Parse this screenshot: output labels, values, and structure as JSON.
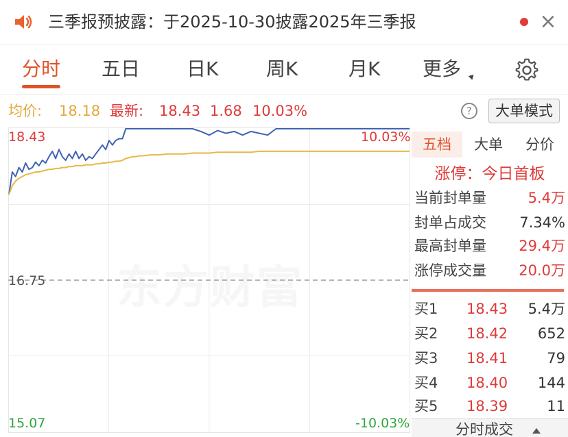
{
  "notice": {
    "text": "三季报预披露：于2025-10-30披露2025年三季报",
    "speaker_icon": "speaker-icon",
    "dot_color": "#e03a3a",
    "close_label": "×"
  },
  "tabs": [
    {
      "label": "分时",
      "active": true
    },
    {
      "label": "五日",
      "active": false
    },
    {
      "label": "日K",
      "active": false
    },
    {
      "label": "周K",
      "active": false
    },
    {
      "label": "月K",
      "active": false
    },
    {
      "label": "更多",
      "active": false
    }
  ],
  "info": {
    "avg_label": "均价:",
    "avg_value": "18.18",
    "latest_label": "最新:",
    "latest_price": "18.43",
    "change": "1.68",
    "change_pct": "10.03%",
    "help_label": "?",
    "mode_button": "大单模式"
  },
  "chart": {
    "y_top": "18.43",
    "y_mid": "16.75",
    "y_bottom": "15.07",
    "pct_top": "10.03%",
    "pct_bottom": "-10.03%",
    "watermark": "东方财富"
  },
  "chart_data": {
    "type": "line",
    "ylim": [
      15.07,
      18.43
    ],
    "prev_close": 16.75,
    "x": [
      0,
      2,
      4,
      6,
      8,
      10,
      12,
      14,
      16,
      18,
      20,
      22,
      24,
      26,
      28,
      30,
      32,
      34,
      36,
      38,
      40,
      42,
      44,
      46,
      48,
      50,
      52,
      54,
      56,
      58,
      60,
      62,
      64,
      66,
      68,
      70,
      72,
      74,
      76,
      78,
      80,
      85,
      90,
      95,
      100,
      105,
      110,
      115,
      120,
      125,
      130,
      135,
      140,
      145,
      150,
      155,
      160,
      165,
      170,
      175,
      180,
      185,
      190,
      195,
      200,
      205,
      210,
      215,
      220,
      225,
      230,
      235,
      240
    ],
    "series": [
      {
        "color": "#3d63b4",
        "values": [
          17.7,
          17.95,
          17.9,
          18.0,
          17.95,
          18.05,
          17.98,
          18.0,
          18.06,
          18.02,
          18.08,
          18.05,
          18.12,
          18.18,
          18.1,
          18.2,
          18.12,
          18.08,
          18.15,
          18.1,
          18.18,
          18.1,
          18.15,
          18.08,
          18.12,
          18.1,
          18.15,
          18.2,
          18.25,
          18.2,
          18.3,
          18.25,
          18.3,
          18.32,
          18.32,
          18.43,
          18.43,
          18.43,
          18.43,
          18.43,
          18.43,
          18.43,
          18.43,
          18.43,
          18.43,
          18.43,
          18.43,
          18.4,
          18.36,
          18.41,
          18.38,
          18.4,
          18.36,
          18.4,
          18.38,
          18.36,
          18.43,
          18.43,
          18.43,
          18.43,
          18.43,
          18.43,
          18.43,
          18.43,
          18.43,
          18.43,
          18.43,
          18.43,
          18.43,
          18.43,
          18.43,
          18.43,
          18.43
        ]
      },
      {
        "color": "#e6b845",
        "values": [
          17.7,
          17.8,
          17.85,
          17.88,
          17.9,
          17.92,
          17.93,
          17.94,
          17.95,
          17.95,
          17.96,
          17.97,
          17.98,
          17.98,
          17.99,
          17.99,
          18.0,
          18.0,
          18.01,
          18.01,
          18.02,
          18.02,
          18.02,
          18.03,
          18.03,
          18.03,
          18.04,
          18.04,
          18.05,
          18.05,
          18.06,
          18.06,
          18.07,
          18.07,
          18.08,
          18.1,
          18.11,
          18.12,
          18.12,
          18.13,
          18.13,
          18.14,
          18.14,
          18.15,
          18.15,
          18.15,
          18.16,
          18.16,
          18.16,
          18.17,
          18.17,
          18.17,
          18.17,
          18.17,
          18.18,
          18.18,
          18.18,
          18.18,
          18.18,
          18.18,
          18.18,
          18.18,
          18.18,
          18.18,
          18.18,
          18.18,
          18.18,
          18.18,
          18.18,
          18.18,
          18.18,
          18.18,
          18.18
        ]
      }
    ]
  },
  "panel": {
    "tabs": [
      {
        "label": "五档",
        "active": true
      },
      {
        "label": "大单",
        "active": false
      },
      {
        "label": "分价",
        "active": false
      }
    ],
    "limit_title": "涨停：今日首板",
    "stats": [
      {
        "label": "当前封单量",
        "value": "5.4万",
        "color": "#e03a3a"
      },
      {
        "label": "封单占成交",
        "value": "7.34%",
        "color": "#333333"
      },
      {
        "label": "最高封单量",
        "value": "29.4万",
        "color": "#e03a3a"
      },
      {
        "label": "涨停成交量",
        "value": "20.0万",
        "color": "#e03a3a"
      }
    ],
    "bids": [
      {
        "name": "买1",
        "price": "18.43",
        "qty": "5.4万"
      },
      {
        "name": "买2",
        "price": "18.42",
        "qty": "652"
      },
      {
        "name": "买3",
        "price": "18.41",
        "qty": "79"
      },
      {
        "name": "买4",
        "price": "18.40",
        "qty": "144"
      },
      {
        "name": "买5",
        "price": "18.39",
        "qty": "11"
      }
    ],
    "bottom_button": "分时成交"
  },
  "colors": {
    "accent": "#e0542a",
    "up": "#e03a3a",
    "down": "#2ea53a",
    "price_line": "#3d63b4",
    "avg_line": "#e6b845"
  }
}
